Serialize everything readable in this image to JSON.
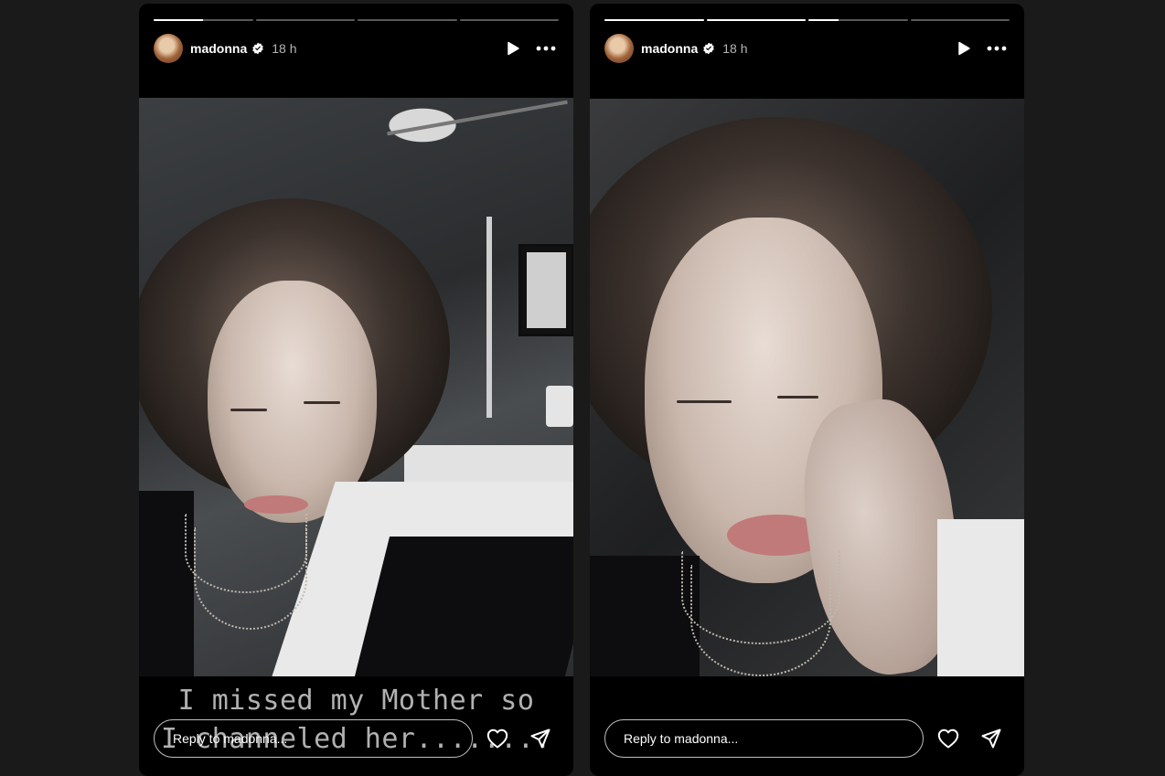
{
  "stories": [
    {
      "progress": [
        0.5,
        0,
        0,
        0
      ],
      "user": {
        "name": "madonna",
        "verified": true,
        "time": "18 h"
      },
      "caption_lines": [
        "I missed my Mother so",
        "I channeled her........"
      ],
      "reply_placeholder": "Reply to madonna..."
    },
    {
      "progress": [
        1,
        1,
        0.3,
        0,
        0
      ],
      "user": {
        "name": "madonna",
        "verified": true,
        "time": "18 h"
      },
      "reply_placeholder": "Reply to madonna..."
    }
  ],
  "icons": {
    "play": "play-icon",
    "more": "more-options-icon",
    "like": "heart-icon",
    "share": "send-icon",
    "verified": "verified-badge-icon"
  },
  "colors": {
    "background": "#1a1a1a",
    "story_bg": "#000000",
    "verified": "#ffffff"
  }
}
